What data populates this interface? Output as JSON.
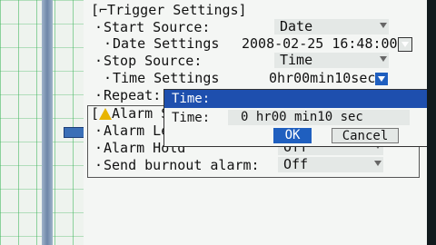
{
  "trigger": {
    "title": "[⌐Trigger Settings]",
    "start_source": {
      "label": "Start Source",
      "value": "Date"
    },
    "date_settings": {
      "label": "Date Settings",
      "value": "2008-02-25 16:48:00"
    },
    "stop_source": {
      "label": "Stop Source",
      "value": "Time"
    },
    "time_settings": {
      "label": "Time Settings",
      "value": "0hr00min10sec"
    },
    "repeat": {
      "label": "Repeat"
    }
  },
  "alarm": {
    "title_prefix": "[",
    "title": "Alarm S",
    "alarm_level": {
      "label": "Alarm Le"
    },
    "alarm_hold": {
      "label": "Alarm Hold",
      "value": "Off"
    },
    "send_burnout": {
      "label": "Send burnout alarm:",
      "value": "Off"
    }
  },
  "dialog": {
    "title": "Time:",
    "field_label": "Time:",
    "field_value": "0 hr00 min10 sec",
    "ok_label": "OK",
    "cancel_label": "Cancel"
  },
  "colors": {
    "highlight": "#1e4fae",
    "warning": "#e8b400"
  },
  "icons": {
    "trigger": "trigger-edge-icon",
    "alarm": "warning-icon",
    "dropdown": "chevron-down-icon"
  }
}
